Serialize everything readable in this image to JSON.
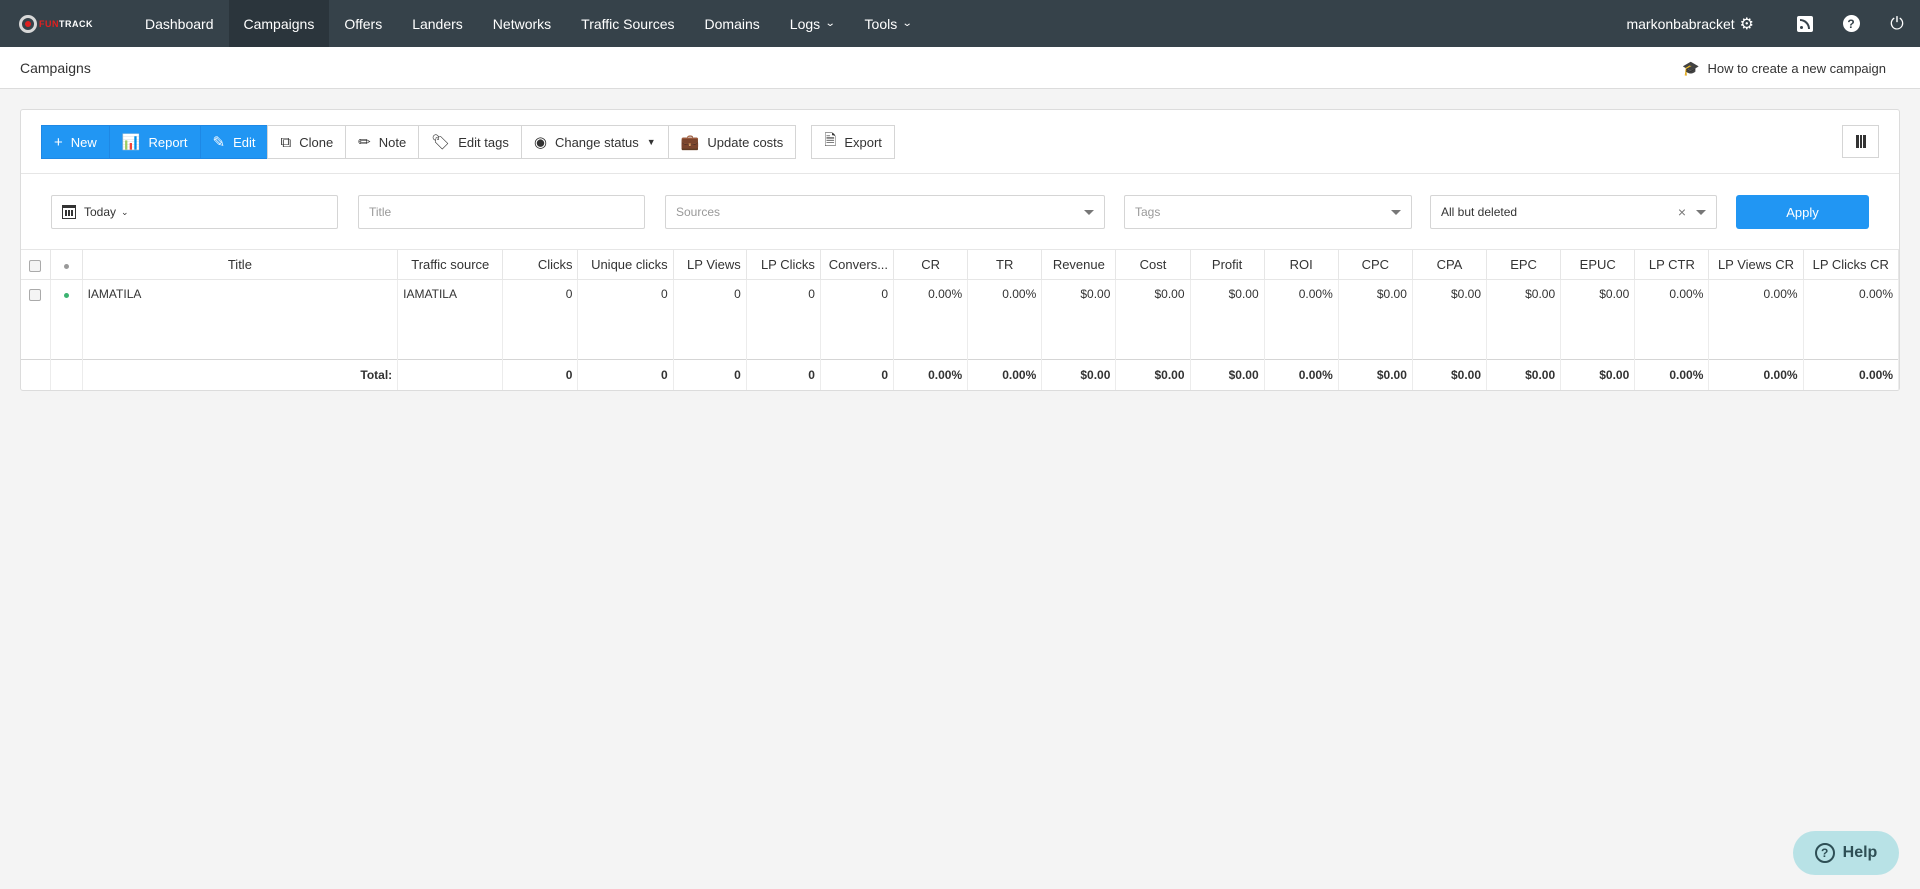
{
  "brand": {
    "logo_red": "FUN",
    "logo_white": "TRACK"
  },
  "nav": {
    "items": [
      {
        "label": "Dashboard"
      },
      {
        "label": "Campaigns"
      },
      {
        "label": "Offers"
      },
      {
        "label": "Landers"
      },
      {
        "label": "Networks"
      },
      {
        "label": "Traffic Sources"
      },
      {
        "label": "Domains"
      },
      {
        "label": "Logs"
      },
      {
        "label": "Tools"
      }
    ],
    "active": "Campaigns",
    "username": "markonbabracket"
  },
  "subheader": {
    "breadcrumb": "Campaigns",
    "howto_label": "How to create a new campaign"
  },
  "toolbar": {
    "new": "New",
    "report": "Report",
    "edit": "Edit",
    "clone": "Clone",
    "note": "Note",
    "edit_tags": "Edit tags",
    "change_status": "Change status",
    "update_costs": "Update costs",
    "export": "Export"
  },
  "filters": {
    "date": "Today",
    "title_placeholder": "Title",
    "sources_placeholder": "Sources",
    "tags_placeholder": "Tags",
    "status": "All but deleted",
    "apply": "Apply"
  },
  "table": {
    "headers": [
      "Title",
      "Traffic source",
      "Clicks",
      "Unique clicks",
      "LP Views",
      "LP Clicks",
      "Convers...",
      "CR",
      "TR",
      "Revenue",
      "Cost",
      "Profit",
      "ROI",
      "CPC",
      "CPA",
      "EPC",
      "EPUC",
      "LP CTR",
      "LP Views CR",
      "LP Clicks CR"
    ],
    "rows": [
      {
        "title": "IAMATILA",
        "source": "IAMATILA",
        "cells": [
          "0",
          "0",
          "0",
          "0",
          "0",
          "0.00%",
          "0.00%",
          "$0.00",
          "$0.00",
          "$0.00",
          "0.00%",
          "$0.00",
          "$0.00",
          "$0.00",
          "$0.00",
          "0.00%",
          "0.00%",
          "0.00%"
        ]
      }
    ],
    "total_label": "Total:",
    "totals": [
      "0",
      "0",
      "0",
      "0",
      "0",
      "0.00%",
      "0.00%",
      "$0.00",
      "$0.00",
      "$0.00",
      "0.00%",
      "$0.00",
      "$0.00",
      "$0.00",
      "$0.00",
      "0.00%",
      "0.00%",
      "0.00%"
    ]
  },
  "help_button": "Help",
  "colors": {
    "nav_bg": "#36424a",
    "accent": "#2196f3",
    "active_dot": "#3cb371"
  }
}
